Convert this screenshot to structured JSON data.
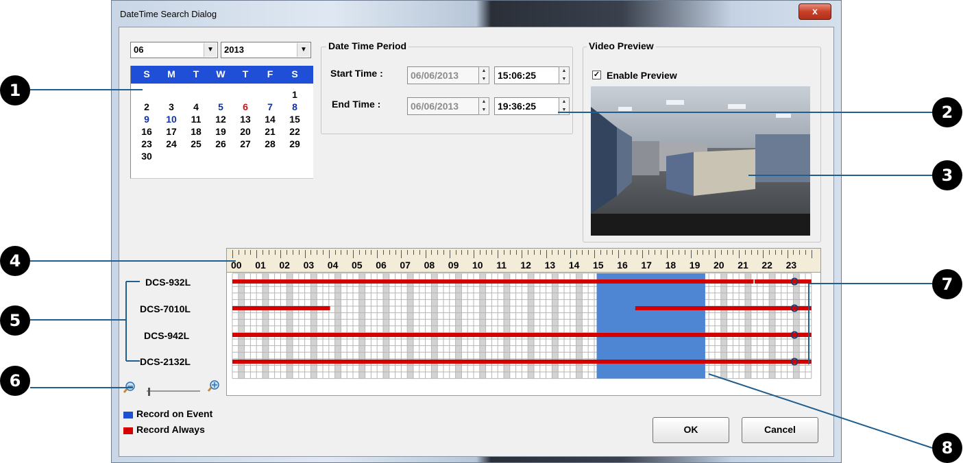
{
  "window": {
    "title": "DateTime Search Dialog",
    "close_glyph": "x"
  },
  "calendar": {
    "month_value": "06",
    "year_value": "2013",
    "weekday_headers": [
      "S",
      "M",
      "T",
      "W",
      "T",
      "F",
      "S"
    ],
    "rows": [
      [
        "",
        "",
        "",
        "",
        "",
        "",
        "1"
      ],
      [
        "2",
        "3",
        "4",
        "5",
        "6",
        "7",
        "8"
      ],
      [
        "9",
        "10",
        "11",
        "12",
        "13",
        "14",
        "15"
      ],
      [
        "16",
        "17",
        "18",
        "19",
        "20",
        "21",
        "22"
      ],
      [
        "23",
        "24",
        "25",
        "26",
        "27",
        "28",
        "29"
      ],
      [
        "30",
        "",
        "",
        "",
        "",
        "",
        ""
      ]
    ],
    "highlight_blue": [
      "5",
      "7",
      "8",
      "9",
      "10"
    ],
    "highlight_red": [
      "6"
    ]
  },
  "period": {
    "group_label": "Date Time Period",
    "start_label": "Start Time :",
    "start_date": "06/06/2013",
    "start_time": "15:06:25",
    "end_label": "End Time :",
    "end_date": "06/06/2013",
    "end_time": "19:36:25"
  },
  "preview": {
    "group_label": "Video Preview",
    "enable_label": "Enable Preview",
    "enabled": true,
    "check_glyph": "✓"
  },
  "timeline": {
    "hours": [
      "00",
      "01",
      "02",
      "03",
      "04",
      "05",
      "06",
      "07",
      "08",
      "09",
      "10",
      "11",
      "12",
      "13",
      "14",
      "15",
      "16",
      "17",
      "18",
      "19",
      "20",
      "21",
      "22",
      "23"
    ],
    "cameras": [
      "DCS-932L",
      "DCS-7010L",
      "DCS-942L",
      "DCS-2132L"
    ],
    "selection_start_hour": 15.1,
    "selection_end_hour": 19.6,
    "recordings": [
      [
        [
          0,
          21.6
        ],
        [
          21.65,
          24
        ]
      ],
      [
        [
          0,
          4.05
        ],
        [
          16.7,
          24
        ]
      ],
      [
        [
          0,
          24
        ]
      ],
      [
        [
          0,
          24
        ]
      ]
    ],
    "colors": {
      "record_always": "#d40000",
      "selection": "#4f86d4"
    }
  },
  "zoom": {
    "out_icon": "zoom-out-icon",
    "in_icon": "zoom-in-icon"
  },
  "legend": [
    {
      "label": "Record on Event",
      "color": "#1f4fd6"
    },
    {
      "label": "Record Always",
      "color": "#d40000"
    }
  ],
  "buttons": {
    "ok_label": "OK",
    "cancel_label": "Cancel"
  },
  "badges": [
    "1",
    "2",
    "3",
    "4",
    "5",
    "6",
    "7",
    "8"
  ]
}
